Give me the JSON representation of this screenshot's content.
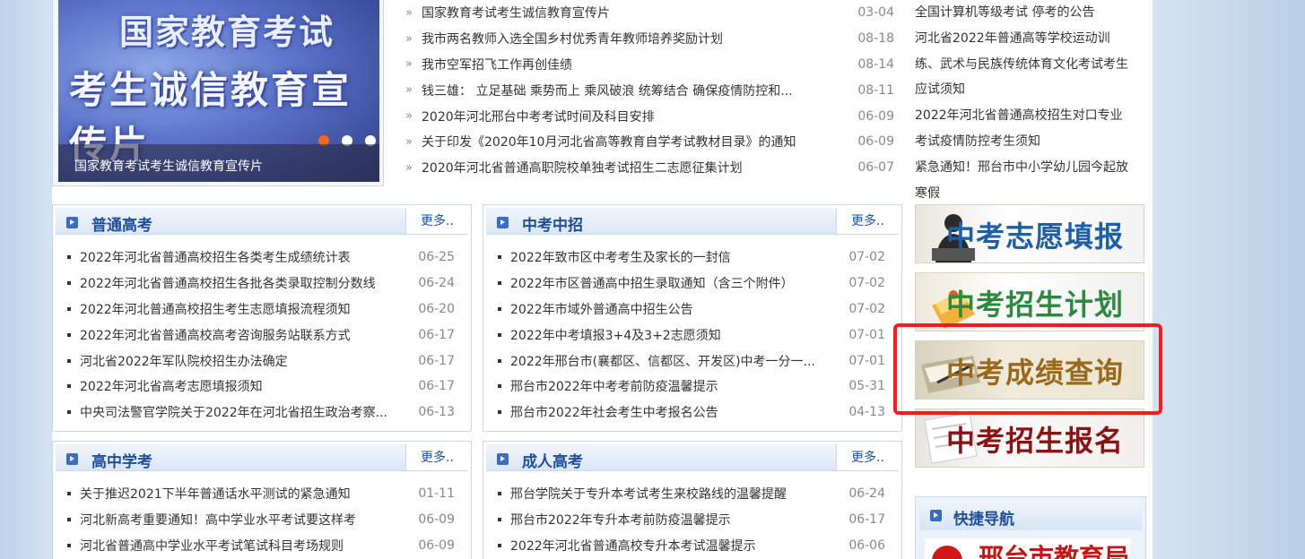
{
  "slideshow": {
    "line1": "国家教育考试",
    "line2": "考生诚信教育宣传片",
    "caption": "国家教育考试考生诚信教育宣传片",
    "dot_colors": {
      "active": "#f06a1d",
      "inactive": "#ffffff"
    }
  },
  "top_news": [
    {
      "title": "国家教育考试考生诚信教育宣传片",
      "date": "03-04"
    },
    {
      "title": "我市两名教师入选全国乡村优秀青年教师培养奖励计划",
      "date": "08-18"
    },
    {
      "title": "我市空军招飞工作再创佳绩",
      "date": "08-14"
    },
    {
      "title": "钱三雄： 立足基础 乘势而上 乘风破浪 统筹结合 确保疫情防控和...",
      "date": "08-11"
    },
    {
      "title": "2020年河北邢台中考考试时间及科目安排",
      "date": "06-09"
    },
    {
      "title": "关于印发《2020年10月河北省高等教育自学考试教材目录》的通知",
      "date": "06-09"
    },
    {
      "title": "2020年河北省普通高职院校单独考试招生二志愿征集计划",
      "date": "06-07"
    }
  ],
  "notices": [
    "全国计算机等级考试 停考的公告",
    "河北省2022年普通高等学校运动训",
    "练、武术与民族传统体育文化考试考生",
    "应试须知",
    "2022年河北省普通高校招生对口专业",
    "考试疫情防控考生须知",
    "紧急通知！邢台市中小学幼儿园今起放",
    "寒假"
  ],
  "more_label": "更多..",
  "panels": {
    "putong": {
      "title": "普通高考",
      "items": [
        {
          "title": "2022年河北省普通高校招生各类考生成绩统计表",
          "date": "06-25"
        },
        {
          "title": "2022年河北省普通高校招生各批各类录取控制分数线",
          "date": "06-24"
        },
        {
          "title": "2022年河北普通高校招生考生志愿填报流程须知",
          "date": "06-20"
        },
        {
          "title": "2022年河北省普通高校高考咨询服务站联系方式",
          "date": "06-17"
        },
        {
          "title": "河北省2022年军队院校招生办法确定",
          "date": "06-17"
        },
        {
          "title": "2022年河北省高考志愿填报须知",
          "date": "06-17"
        },
        {
          "title": "中央司法警官学院关于2022年在河北省招生政治考察...",
          "date": "06-13"
        }
      ]
    },
    "zhongkao": {
      "title": "中考中招",
      "items": [
        {
          "title": "2022年致市区中考考生及家长的一封信",
          "date": "07-02"
        },
        {
          "title": "2022年市区普通高中招生录取通知（含三个附件）",
          "date": "07-02"
        },
        {
          "title": "2022年市域外普通高中招生公告",
          "date": "07-02"
        },
        {
          "title": "2022年中考填报3+4及3+2志愿须知",
          "date": "07-01"
        },
        {
          "title": "2022年邢台市(襄都区、信都区、开发区)中考一分一...",
          "date": "07-01"
        },
        {
          "title": "邢台市2022年中考考前防疫温馨提示",
          "date": "05-31"
        },
        {
          "title": "邢台市2022年社会考生中考报名公告",
          "date": "04-13"
        }
      ]
    },
    "gaozhong": {
      "title": "高中学考",
      "items": [
        {
          "title": "关于推迟2021下半年普通话水平测试的紧急通知",
          "date": "01-11"
        },
        {
          "title": "河北新高考重要通知！高中学业水平考试要这样考",
          "date": "06-09"
        },
        {
          "title": "河北省普通高中学业水平考试笔试科目考场规则",
          "date": "06-09"
        }
      ]
    },
    "chengren": {
      "title": "成人高考",
      "items": [
        {
          "title": "邢台学院关于专升本考试考生来校路线的温馨提醒",
          "date": "06-24"
        },
        {
          "title": "邢台市2022年专升本考前防疫温馨提示",
          "date": "06-17"
        },
        {
          "title": "2022年河北省普通高校专升本考试温馨提示",
          "date": "06-06"
        }
      ]
    }
  },
  "banners": [
    {
      "label": "中考志愿填报",
      "color": "#1d5fa8"
    },
    {
      "label": "中考招生计划",
      "color": "#2b8a3e"
    },
    {
      "label": "中考成绩查询",
      "color": "#9a6a1c"
    },
    {
      "label": "中考招生报名",
      "color": "#8a1414"
    }
  ],
  "quick_nav": {
    "title": "快捷导航",
    "logo_text": "邢台市教育局"
  },
  "highlight_color": "#ff1a1a"
}
